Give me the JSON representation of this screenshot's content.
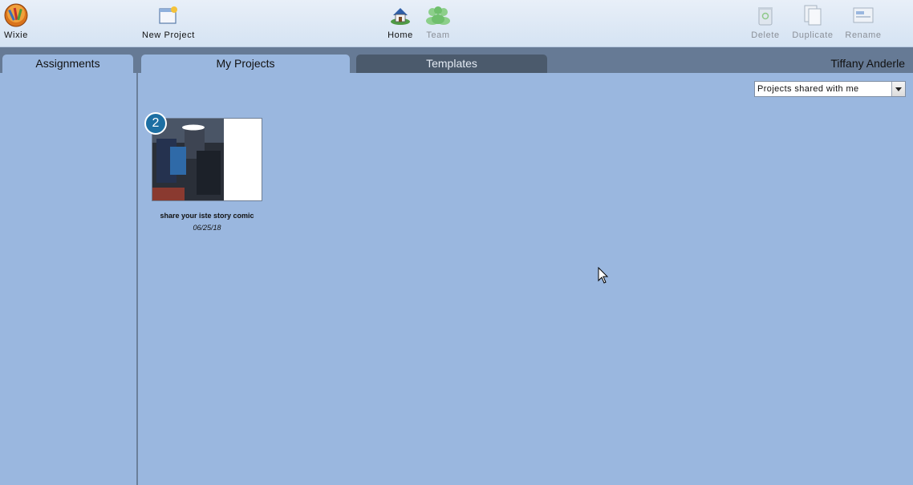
{
  "toolbar": {
    "wixie_label": "Wixie",
    "new_project_label": "New Project",
    "home_label": "Home",
    "team_label": "Team",
    "delete_label": "Delete",
    "duplicate_label": "Duplicate",
    "rename_label": "Rename"
  },
  "tabs": {
    "assignments": "Assignments",
    "my_projects": "My Projects",
    "templates": "Templates"
  },
  "user": {
    "name": "Tiffany Anderle"
  },
  "filter": {
    "selected": "Projects shared with me"
  },
  "projects": [
    {
      "title": "share your iste story comic",
      "date": "06/25/18",
      "badge": "2"
    }
  ],
  "icons": {
    "wixie": "wixie-logo-icon",
    "new_project": "new-project-icon",
    "home": "home-icon",
    "team": "team-icon",
    "delete": "trash-icon",
    "duplicate": "duplicate-icon",
    "rename": "rename-icon",
    "dropdown": "chevron-down-icon",
    "cursor": "mouse-pointer-icon"
  },
  "colors": {
    "background": "#9ab7df",
    "tab_strip": "#667a95",
    "inactive_tab": "#4b5a6c",
    "badge": "#1d6fa3"
  }
}
